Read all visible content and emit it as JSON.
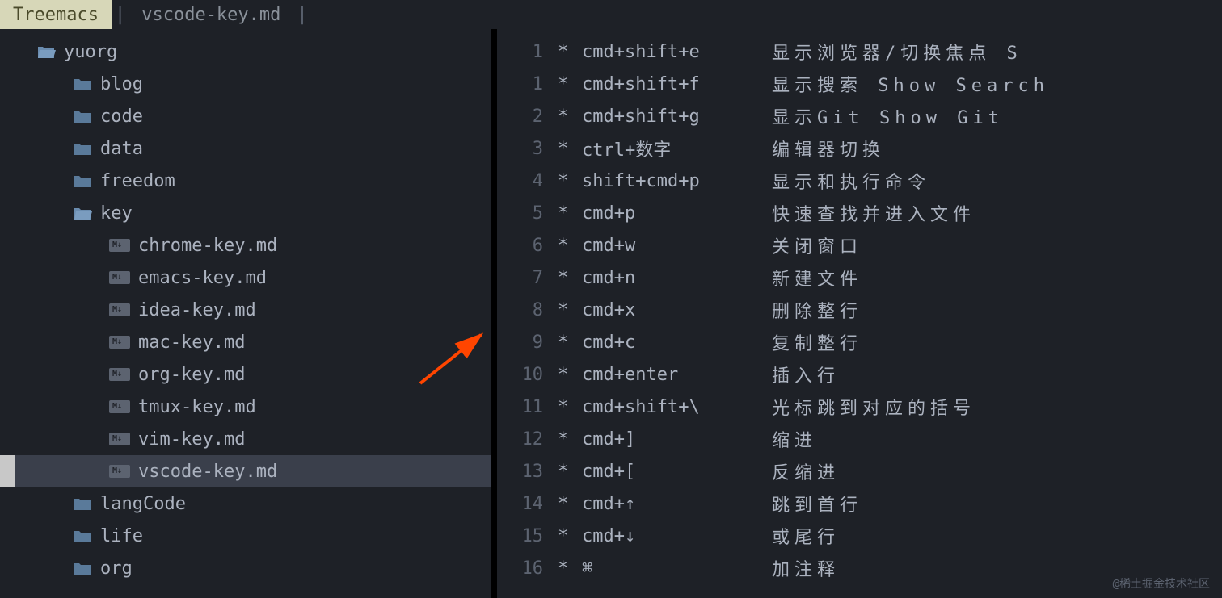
{
  "tabs": {
    "active": "Treemacs",
    "file": "vscode-key.md"
  },
  "tree": {
    "root": "yuorg",
    "folders_l1": [
      "blog",
      "code",
      "data",
      "freedom"
    ],
    "folder_open": "key",
    "files": [
      "chrome-key.md",
      "emacs-key.md",
      "idea-key.md",
      "mac-key.md",
      "org-key.md",
      "tmux-key.md",
      "vim-key.md",
      "vscode-key.md"
    ],
    "folders_after": [
      "langCode",
      "life",
      "org"
    ],
    "selected": "vscode-key.md"
  },
  "editor": {
    "lines": [
      {
        "num": "1",
        "key": "cmd+shift+e",
        "desc": "显示浏览器/切换焦点 S"
      },
      {
        "num": "1",
        "key": "cmd+shift+f",
        "desc": "显示搜索 Show Search"
      },
      {
        "num": "2",
        "key": "cmd+shift+g",
        "desc": "显示Git Show Git"
      },
      {
        "num": "3",
        "key": "ctrl+数字",
        "desc": " 编辑器切换"
      },
      {
        "num": "4",
        "key": "shift+cmd+p",
        "desc": "显示和执行命令"
      },
      {
        "num": "5",
        "key": "cmd+p",
        "desc": "快速查找并进入文件"
      },
      {
        "num": "6",
        "key": "cmd+w",
        "desc": "关闭窗口"
      },
      {
        "num": "7",
        "key": "cmd+n",
        "desc": "新建文件"
      },
      {
        "num": "8",
        "key": "cmd+x",
        "desc": "删除整行"
      },
      {
        "num": "9",
        "key": "cmd+c",
        "desc": "复制整行"
      },
      {
        "num": "10",
        "key": "cmd+enter",
        "desc": "插入行"
      },
      {
        "num": "11",
        "key": "cmd+shift+\\",
        "desc": "光标跳到对应的括号"
      },
      {
        "num": "12",
        "key": "cmd+]",
        "desc": "缩进"
      },
      {
        "num": "13",
        "key": "cmd+[",
        "desc": "反缩进"
      },
      {
        "num": "14",
        "key": "cmd+↑",
        "desc": "跳到首行"
      },
      {
        "num": "15",
        "key": "cmd+↓",
        "desc": "或尾行"
      },
      {
        "num": "16",
        "key": "⌘",
        "desc": "加注释"
      }
    ]
  },
  "watermark": "@稀土掘金技术社区",
  "icons": {
    "md_badge": "M↓"
  }
}
